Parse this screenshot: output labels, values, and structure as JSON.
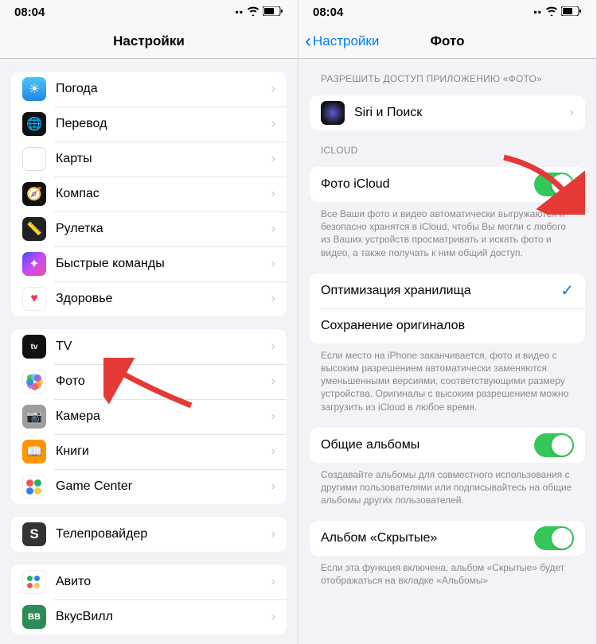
{
  "left": {
    "time": "08:04",
    "title": "Настройки",
    "groups": [
      {
        "items": [
          {
            "label": "Погода",
            "iconClass": "ic-weather",
            "iconGlyph": "☀"
          },
          {
            "label": "Перевод",
            "iconClass": "ic-translate",
            "iconGlyph": "🌐"
          },
          {
            "label": "Карты",
            "iconClass": "ic-maps",
            "iconGlyph": "🗺"
          },
          {
            "label": "Компас",
            "iconClass": "ic-compass",
            "iconGlyph": "🧭"
          },
          {
            "label": "Рулетка",
            "iconClass": "ic-measure",
            "iconGlyph": "📏"
          },
          {
            "label": "Быстрые команды",
            "iconClass": "ic-shortcuts",
            "iconGlyph": "✦"
          },
          {
            "label": "Здоровье",
            "iconClass": "ic-health",
            "iconGlyph": "♥"
          }
        ]
      },
      {
        "items": [
          {
            "label": "TV",
            "iconClass": "ic-tv",
            "iconGlyph": "tv"
          },
          {
            "label": "Фото",
            "iconClass": "ic-photos",
            "iconGlyph": ""
          },
          {
            "label": "Камера",
            "iconClass": "ic-camera",
            "iconGlyph": "📷"
          },
          {
            "label": "Книги",
            "iconClass": "ic-books",
            "iconGlyph": "📖"
          },
          {
            "label": "Game Center",
            "iconClass": "ic-gc",
            "iconGlyph": ""
          }
        ]
      },
      {
        "items": [
          {
            "label": "Телепровайдер",
            "iconClass": "ic-teleprov",
            "iconGlyph": "S"
          }
        ]
      },
      {
        "items": [
          {
            "label": "Авито",
            "iconClass": "ic-avito",
            "iconGlyph": ""
          },
          {
            "label": "ВкусВилл",
            "iconClass": "ic-vkus",
            "iconGlyph": "ВВ"
          }
        ]
      }
    ]
  },
  "right": {
    "time": "08:04",
    "back": "Настройки",
    "title": "Фото",
    "section_access": "РАЗРЕШИТЬ ДОСТУП ПРИЛОЖЕНИЮ «ФОТО»",
    "siri_label": "Siri и Поиск",
    "section_icloud": "ICLOUD",
    "icloud_photo_label": "Фото iCloud",
    "icloud_footer": "Все Ваши фото и видео автоматически выгружаются и безопасно хранятся в iCloud, чтобы Вы могли с любого из Ваших устройств просматривать и искать фото и видео, а также получать к ним общий доступ.",
    "optimize_label": "Оптимизация хранилища",
    "originals_label": "Сохранение оригиналов",
    "storage_footer": "Если место на iPhone заканчивается, фото и видео с высоким разрешением автоматически заменяются уменьшенными версиями, соответствующими размеру устройства. Оригиналы с высоким разрешением можно загрузить из iCloud в любое время.",
    "shared_label": "Общие альбомы",
    "shared_footer": "Создавайте альбомы для совместного использования с другими пользователями или подписывайтесь на общие альбомы других пользователей.",
    "hidden_label": "Альбом «Скрытые»",
    "hidden_footer": "Если эта функция включена, альбом «Скрытые» будет отображаться на вкладке «Альбомы»"
  }
}
